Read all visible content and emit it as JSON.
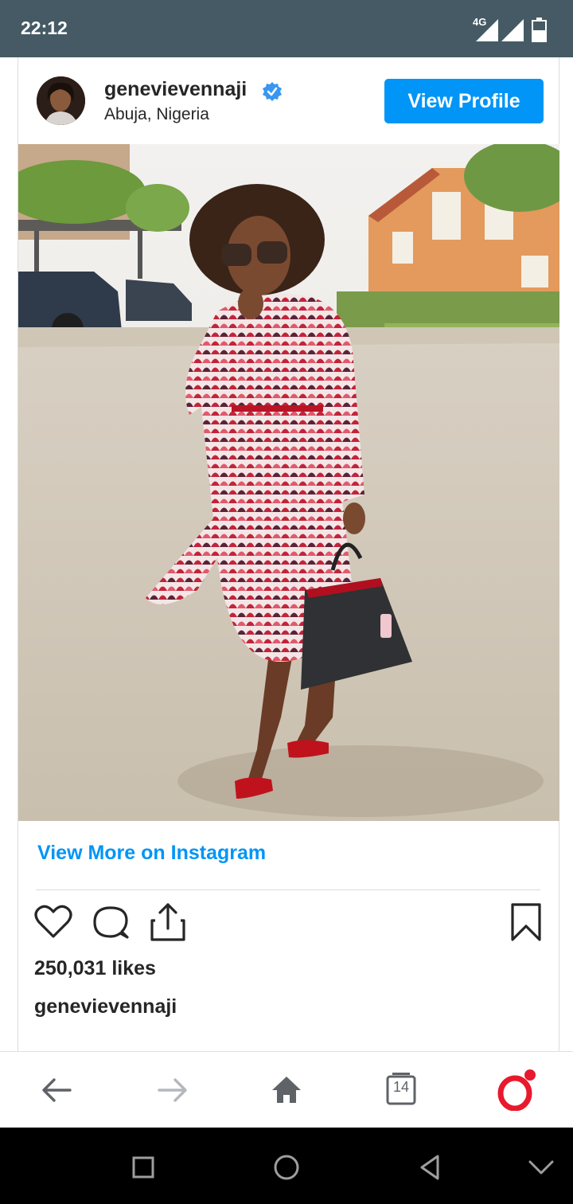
{
  "status_bar": {
    "time": "22:12",
    "network": "4G",
    "icons": [
      "signal-4g-icon",
      "signal-icon",
      "battery-icon"
    ]
  },
  "post": {
    "username": "genevievennaji",
    "verified": true,
    "location": "Abuja, Nigeria",
    "view_profile_label": "View Profile",
    "photo_alt": "Woman in a red patterned shirt dress holding a black tote bag",
    "view_more_label": "View More on Instagram",
    "likes": "250,031 likes",
    "caption_username": "genevievennaji",
    "actions": [
      "heart-icon",
      "comment-icon",
      "share-icon",
      "bookmark-icon"
    ]
  },
  "browser": {
    "tab_count": "14",
    "buttons": [
      "back-arrow-icon",
      "forward-arrow-icon",
      "home-icon",
      "tabs-icon",
      "opera-menu-icon"
    ]
  },
  "system_nav": [
    "recents-square-icon",
    "home-circle-icon",
    "back-triangle-icon",
    "collapse-chevron-icon"
  ],
  "colors": {
    "status_bar": "#455a64",
    "instagram_blue": "#0095f6",
    "opera_red": "#e8192c",
    "text_dark": "#262626"
  }
}
